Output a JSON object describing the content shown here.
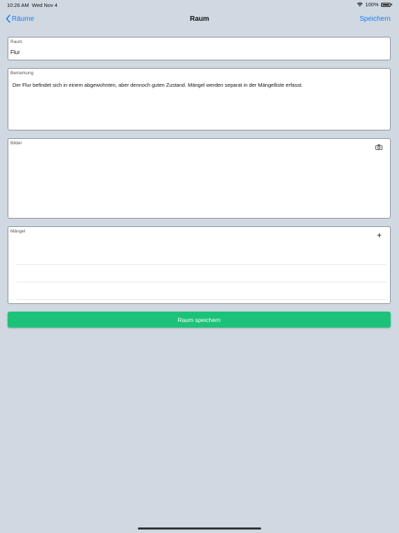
{
  "status": {
    "time": "10:26 AM",
    "date": "Wed Nov 4",
    "battery": "100%"
  },
  "nav": {
    "back_label": "Räume",
    "title": "Raum",
    "save_label": "Speichern"
  },
  "form": {
    "raum": {
      "label": "Raum",
      "value": "Flur"
    },
    "bemerkung": {
      "label": "Bemerkung",
      "value": "Der Flur befindet sich in einem abgewohnten, aber dennoch guten Zustand. Mängel werden separat in der Mängelliste erfasst."
    },
    "bilder": {
      "label": "Bilder",
      "icon": "camera-icon"
    },
    "maengel": {
      "label": "Mängel",
      "icon": "plus-icon"
    }
  },
  "save_button": {
    "label": "Raum speichern"
  },
  "colors": {
    "accent": "#1a7cf5",
    "save_button": "#1cc27a",
    "background": "#d0d9e1"
  }
}
